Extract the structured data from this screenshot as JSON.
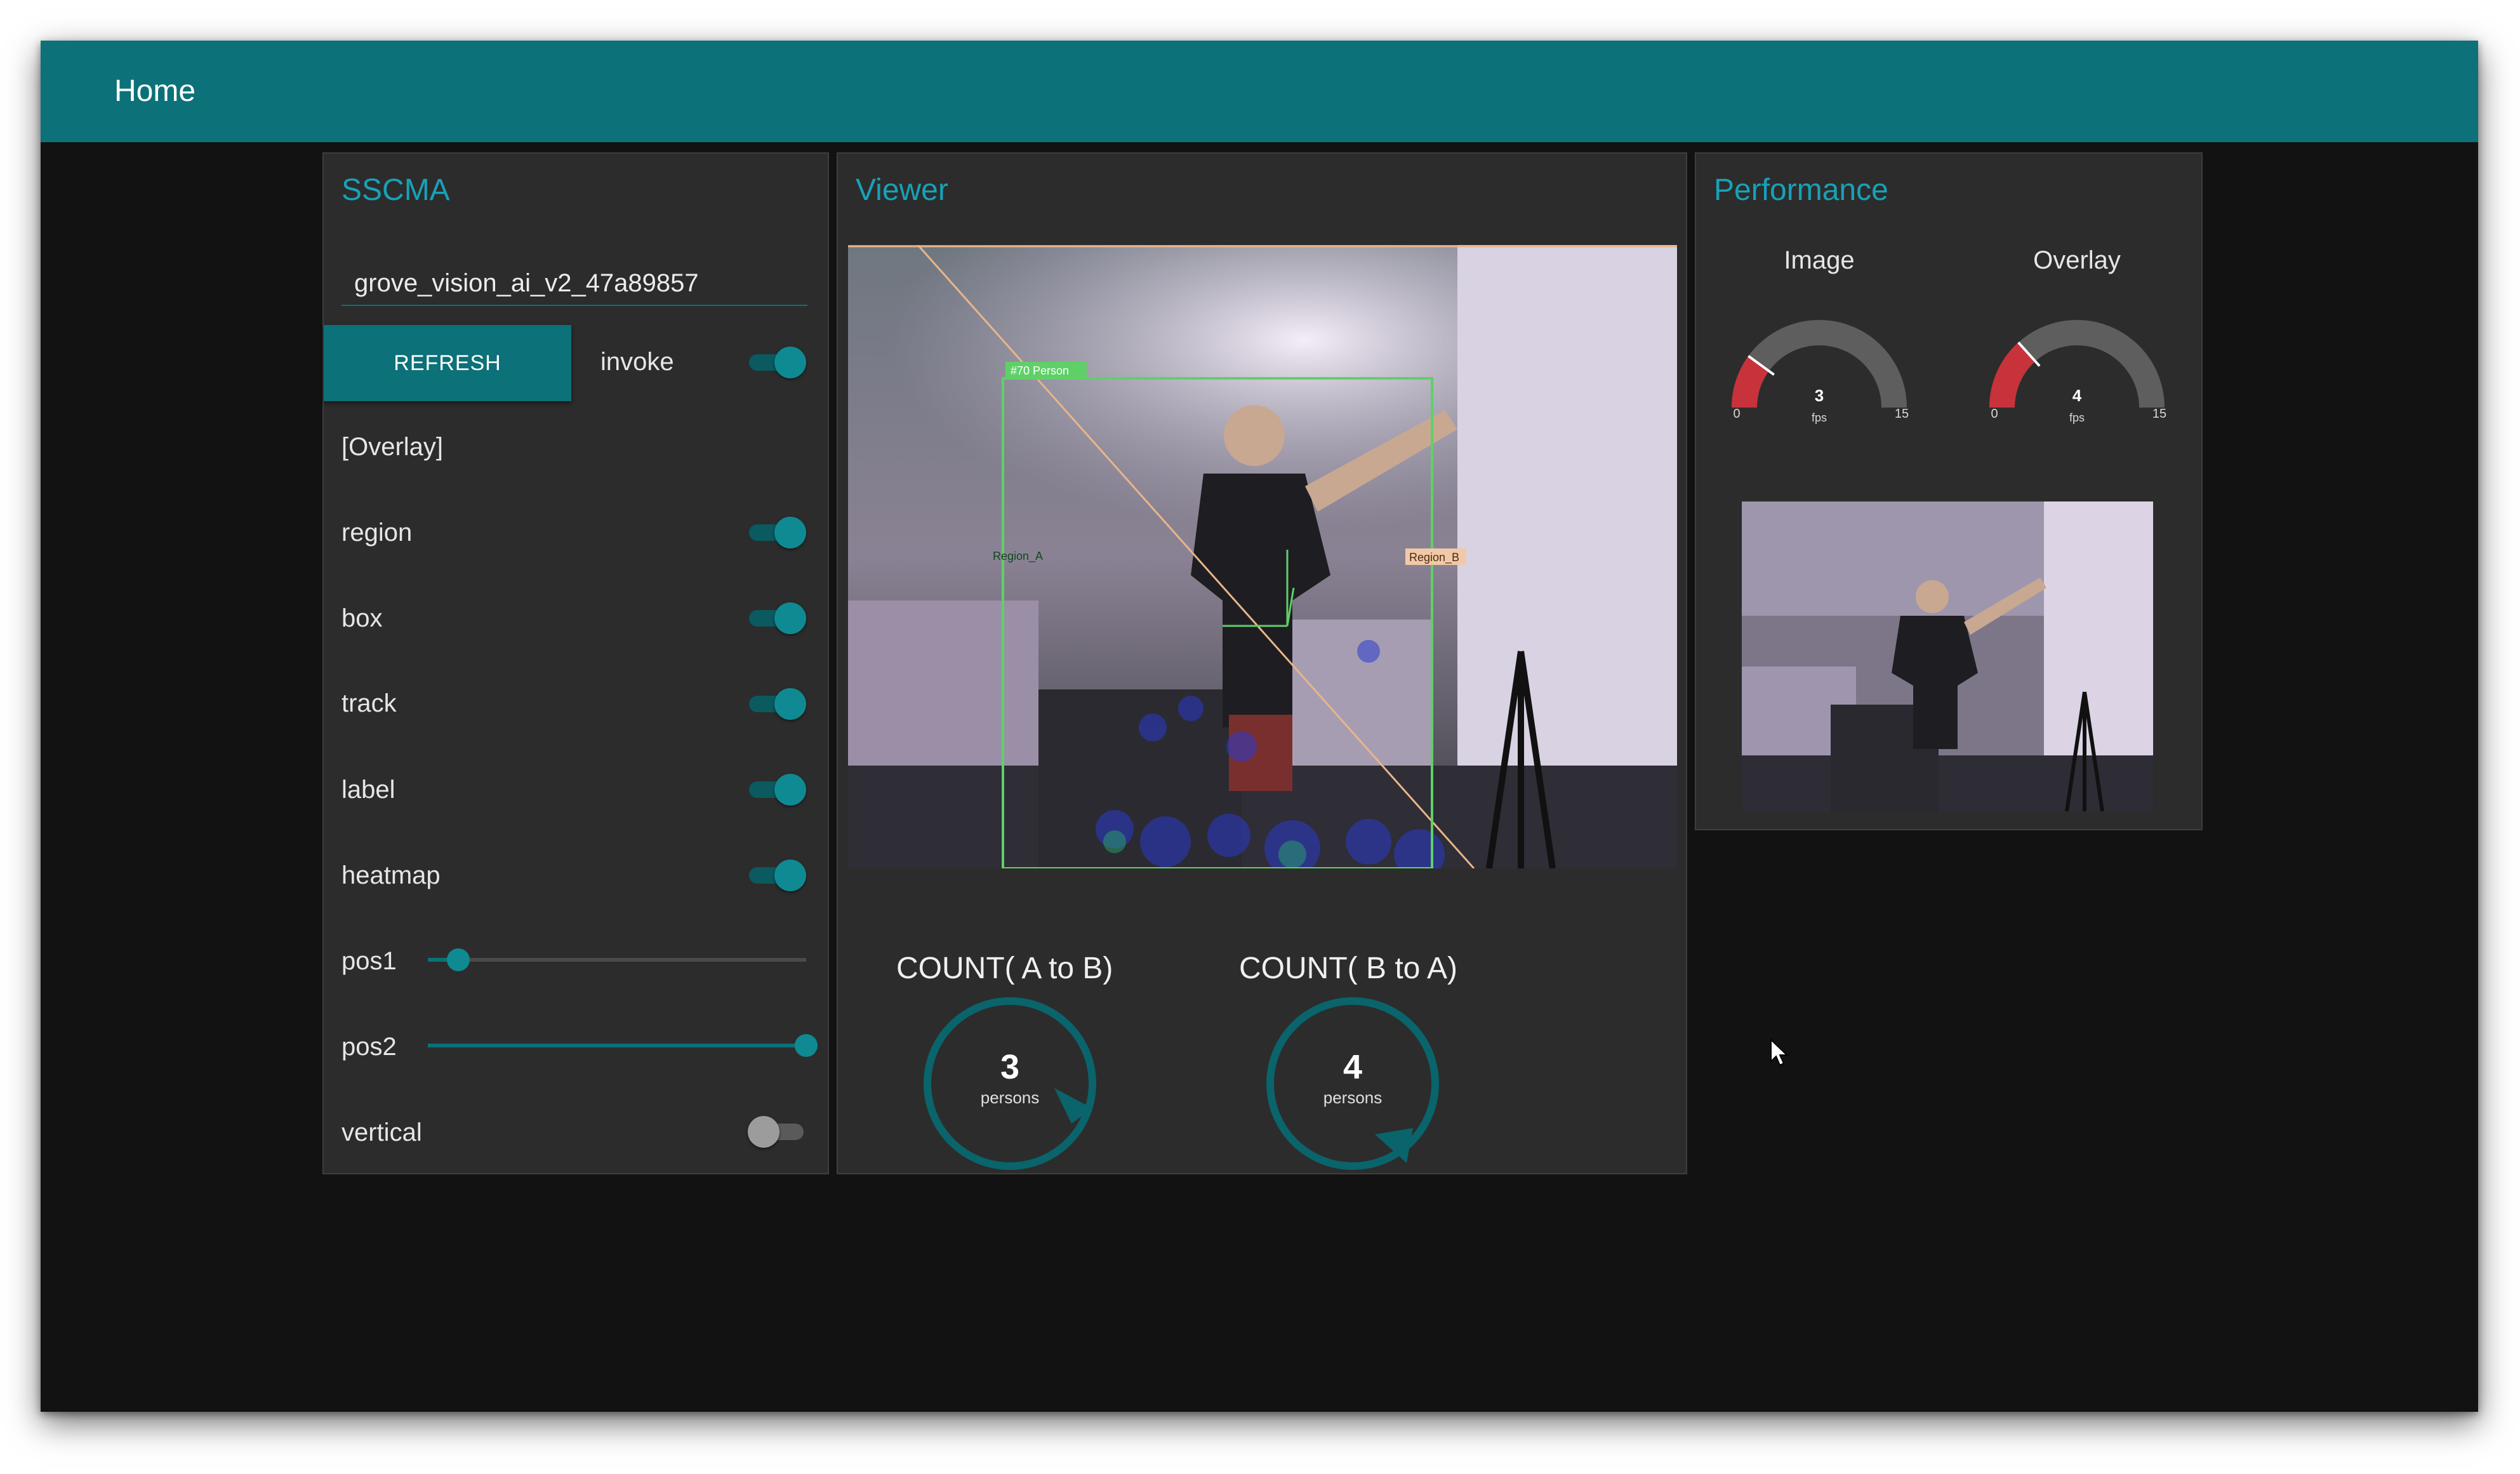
{
  "appbar": {
    "title": "Home"
  },
  "sscma": {
    "title": "SSCMA",
    "device_value": "grove_vision_ai_v2_47a89857",
    "refresh_label": "REFRESH",
    "invoke": {
      "label": "invoke",
      "on": true
    },
    "overlay_header": "[Overlay]",
    "toggles": [
      {
        "label": "region",
        "on": true
      },
      {
        "label": "box",
        "on": true
      },
      {
        "label": "track",
        "on": true
      },
      {
        "label": "label",
        "on": true
      },
      {
        "label": "heatmap",
        "on": true
      }
    ],
    "sliders": [
      {
        "label": "pos1",
        "value": 0.08
      },
      {
        "label": "pos2",
        "value": 1.0
      }
    ],
    "vertical": {
      "label": "vertical",
      "on": false
    }
  },
  "viewer": {
    "title": "Viewer",
    "overlay": {
      "box_label": "#70 Person",
      "region_a": "Region_A",
      "region_b": "Region_B"
    },
    "counts": [
      {
        "title": "COUNT( A to B)",
        "value": "3",
        "unit": "persons"
      },
      {
        "title": "COUNT( B to A)",
        "value": "4",
        "unit": "persons"
      }
    ]
  },
  "performance": {
    "title": "Performance",
    "gauges": [
      {
        "label": "Image",
        "value": 3,
        "min": 0,
        "max": 15,
        "unit": "fps"
      },
      {
        "label": "Overlay",
        "value": 4,
        "min": 0,
        "max": 15,
        "unit": "fps"
      }
    ]
  },
  "colors": {
    "accent": "#0c7178",
    "title": "#17a2b8",
    "card": "#2c2c2c",
    "gauge_red": "#c8323a",
    "gauge_gray": "#5e5e5e"
  },
  "icons": {
    "cursor": "mouse-pointer-icon"
  }
}
